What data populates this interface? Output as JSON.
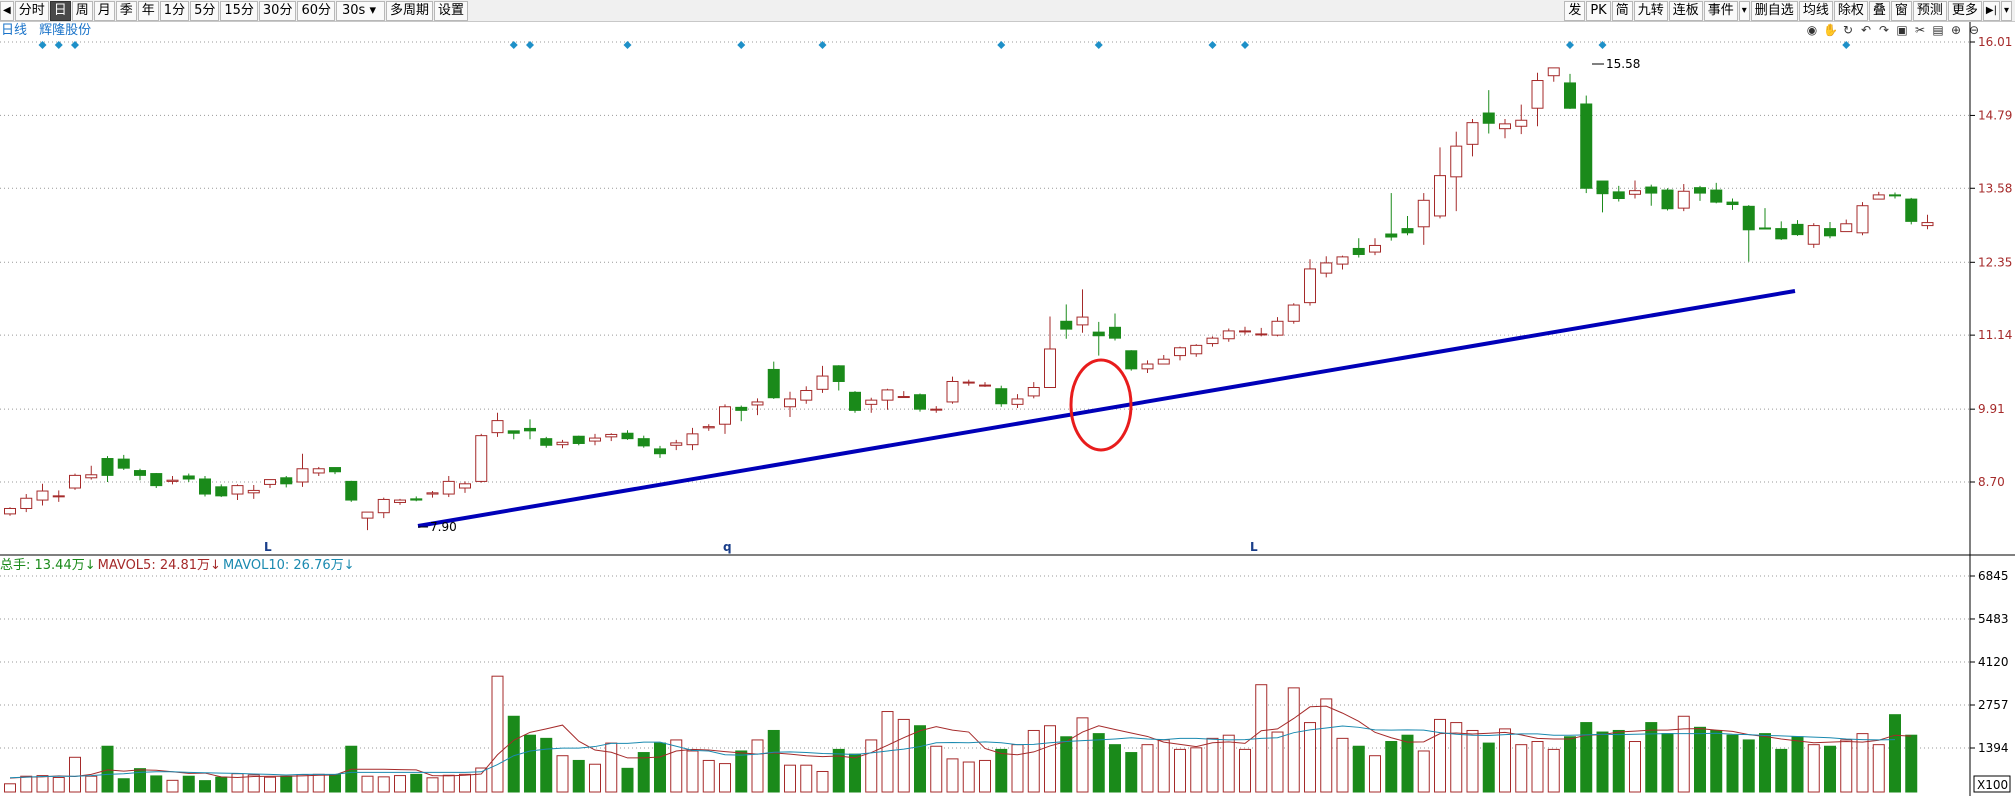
{
  "toolbar": {
    "left": [
      "分时",
      "日",
      "周",
      "月",
      "季",
      "年",
      "1分",
      "5分",
      "15分",
      "30分",
      "60分",
      "30s",
      "多周期",
      "设置"
    ],
    "right": [
      "发",
      "PK",
      "简",
      "九转",
      "连板",
      "事件",
      "删自选",
      "均线",
      "除权",
      "叠",
      "窗",
      "预测",
      "更多"
    ],
    "active": "日"
  },
  "stock": {
    "period": "日线",
    "name": "辉隆股份"
  },
  "tools": [
    "eye-icon",
    "hand-icon",
    "refresh-icon",
    "undo-icon",
    "redo-icon",
    "lock-icon",
    "scissors-icon",
    "delete-icon",
    "zoom-in-icon",
    "zoom-out-icon"
  ],
  "chart_data": [
    {
      "type": "candlestick",
      "title": "",
      "yticks": [
        16.01,
        14.79,
        13.58,
        12.35,
        11.14,
        9.91,
        8.7
      ],
      "ylim": [
        7.75,
        16.15
      ],
      "price_labels": {
        "high": "15.58",
        "low": "7.90"
      },
      "bottom_markers": [
        "L",
        "q",
        "L"
      ],
      "colors": {
        "up": "#a52a2a",
        "down": "#1a8a1a",
        "trend": "#0000b8",
        "circle": "#e81c1c",
        "diamond": "#1e90c8"
      },
      "candles": [
        [
          8.17,
          8.26,
          8.14,
          8.28
        ],
        [
          8.26,
          8.43,
          8.2,
          8.5
        ],
        [
          8.4,
          8.55,
          8.31,
          8.67
        ],
        [
          8.46,
          8.47,
          8.37,
          8.56
        ],
        [
          8.6,
          8.81,
          8.57,
          8.84
        ],
        [
          8.77,
          8.82,
          8.74,
          8.97
        ],
        [
          9.09,
          8.81,
          8.7,
          9.13
        ],
        [
          9.08,
          8.93,
          8.9,
          9.15
        ],
        [
          8.89,
          8.81,
          8.73,
          8.92
        ],
        [
          8.84,
          8.64,
          8.6,
          8.85
        ],
        [
          8.71,
          8.73,
          8.66,
          8.8
        ],
        [
          8.8,
          8.75,
          8.7,
          8.84
        ],
        [
          8.75,
          8.5,
          8.46,
          8.8
        ],
        [
          8.62,
          8.47,
          8.45,
          8.66
        ],
        [
          8.5,
          8.64,
          8.4,
          8.66
        ],
        [
          8.52,
          8.56,
          8.42,
          8.65
        ],
        [
          8.66,
          8.74,
          8.6,
          8.74
        ],
        [
          8.77,
          8.67,
          8.61,
          8.8
        ],
        [
          8.7,
          8.92,
          8.62,
          9.17
        ],
        [
          8.85,
          8.92,
          8.8,
          8.95
        ],
        [
          8.94,
          8.87,
          8.83,
          8.94
        ],
        [
          8.71,
          8.4,
          8.37,
          8.72
        ],
        [
          8.1,
          8.2,
          7.9,
          8.2
        ],
        [
          8.19,
          8.41,
          8.1,
          8.44
        ],
        [
          8.36,
          8.4,
          8.32,
          8.42
        ],
        [
          8.42,
          8.4,
          8.38,
          8.46
        ],
        [
          8.5,
          8.52,
          8.44,
          8.55
        ],
        [
          8.5,
          8.71,
          8.45,
          8.8
        ],
        [
          8.6,
          8.67,
          8.52,
          8.71
        ],
        [
          8.71,
          9.47,
          8.69,
          9.5
        ],
        [
          9.52,
          9.72,
          9.45,
          9.85
        ],
        [
          9.55,
          9.51,
          9.41,
          9.55
        ],
        [
          9.59,
          9.55,
          9.41,
          9.74
        ],
        [
          9.42,
          9.31,
          9.27,
          9.45
        ],
        [
          9.32,
          9.36,
          9.26,
          9.4
        ],
        [
          9.46,
          9.34,
          9.31,
          9.47
        ],
        [
          9.38,
          9.43,
          9.31,
          9.5
        ],
        [
          9.45,
          9.49,
          9.38,
          9.51
        ],
        [
          9.51,
          9.42,
          9.4,
          9.56
        ],
        [
          9.42,
          9.3,
          9.27,
          9.47
        ],
        [
          9.25,
          9.17,
          9.1,
          9.3
        ],
        [
          9.31,
          9.35,
          9.23,
          9.4
        ],
        [
          9.32,
          9.5,
          9.23,
          9.6
        ],
        [
          9.6,
          9.62,
          9.55,
          9.66
        ],
        [
          9.66,
          9.95,
          9.5,
          9.99
        ],
        [
          9.94,
          9.89,
          9.71,
          9.97
        ],
        [
          9.98,
          10.03,
          9.81,
          10.09
        ],
        [
          10.57,
          10.1,
          10.08,
          10.7
        ],
        [
          9.95,
          10.08,
          9.78,
          10.2
        ],
        [
          10.06,
          10.22,
          10.0,
          10.29
        ],
        [
          10.24,
          10.46,
          10.18,
          10.63
        ],
        [
          10.63,
          10.37,
          10.22,
          10.64
        ],
        [
          10.19,
          9.89,
          9.85,
          10.21
        ],
        [
          9.99,
          10.06,
          9.85,
          10.1
        ],
        [
          10.06,
          10.23,
          9.9,
          10.25
        ],
        [
          10.12,
          10.12,
          10.1,
          10.21
        ],
        [
          10.15,
          9.91,
          9.87,
          10.17
        ],
        [
          9.91,
          9.91,
          9.85,
          9.96
        ],
        [
          10.03,
          10.37,
          10.0,
          10.45
        ],
        [
          10.36,
          10.36,
          10.3,
          10.4
        ],
        [
          10.31,
          10.31,
          10.28,
          10.36
        ],
        [
          10.25,
          10.0,
          9.95,
          10.3
        ],
        [
          9.99,
          10.08,
          9.93,
          10.16
        ],
        [
          10.13,
          10.27,
          10.09,
          10.36
        ],
        [
          10.27,
          10.91,
          10.27,
          11.45
        ],
        [
          11.37,
          11.24,
          11.08,
          11.65
        ],
        [
          11.31,
          11.44,
          11.18,
          11.9
        ],
        [
          11.19,
          11.13,
          10.8,
          11.36
        ],
        [
          11.27,
          11.09,
          11.05,
          11.5
        ],
        [
          10.88,
          10.58,
          10.55,
          10.89
        ],
        [
          10.58,
          10.66,
          10.51,
          10.72
        ],
        [
          10.66,
          10.74,
          10.66,
          10.81
        ],
        [
          10.8,
          10.93,
          10.72,
          10.95
        ],
        [
          10.83,
          10.97,
          10.78,
          10.99
        ],
        [
          11.0,
          11.09,
          10.95,
          11.12
        ],
        [
          11.08,
          11.21,
          11.03,
          11.25
        ],
        [
          11.2,
          11.21,
          11.15,
          11.28
        ],
        [
          11.16,
          11.16,
          11.12,
          11.26
        ],
        [
          11.14,
          11.37,
          11.12,
          11.44
        ],
        [
          11.37,
          11.64,
          11.33,
          11.67
        ],
        [
          11.68,
          12.24,
          11.63,
          12.4
        ],
        [
          12.17,
          12.34,
          12.1,
          12.45
        ],
        [
          12.32,
          12.44,
          12.23,
          12.46
        ],
        [
          12.58,
          12.48,
          12.43,
          12.75
        ],
        [
          12.52,
          12.63,
          12.47,
          12.75
        ],
        [
          12.82,
          12.77,
          12.71,
          13.5
        ],
        [
          12.91,
          12.84,
          12.8,
          13.12
        ],
        [
          12.94,
          13.38,
          12.64,
          13.5
        ],
        [
          13.12,
          13.79,
          13.08,
          14.26
        ],
        [
          13.77,
          14.28,
          13.2,
          14.52
        ],
        [
          14.31,
          14.67,
          14.11,
          14.73
        ],
        [
          14.83,
          14.66,
          14.49,
          15.21
        ],
        [
          14.57,
          14.65,
          14.41,
          14.73
        ],
        [
          14.61,
          14.71,
          14.48,
          14.97
        ],
        [
          14.91,
          15.37,
          14.61,
          15.5
        ],
        [
          15.45,
          15.58,
          15.35,
          15.58
        ],
        [
          15.33,
          14.91,
          14.9,
          15.48
        ],
        [
          14.98,
          13.58,
          13.5,
          15.12
        ],
        [
          13.7,
          13.49,
          13.18,
          13.7
        ],
        [
          13.52,
          13.41,
          13.36,
          13.62
        ],
        [
          13.48,
          13.54,
          13.41,
          13.71
        ],
        [
          13.6,
          13.5,
          13.29,
          13.64
        ],
        [
          13.55,
          13.24,
          13.21,
          13.58
        ],
        [
          13.25,
          13.53,
          13.2,
          13.65
        ],
        [
          13.59,
          13.5,
          13.37,
          13.62
        ],
        [
          13.55,
          13.35,
          13.33,
          13.67
        ],
        [
          13.35,
          13.31,
          13.22,
          13.41
        ],
        [
          13.28,
          12.89,
          12.36,
          13.3
        ],
        [
          12.92,
          12.91,
          12.9,
          13.25
        ],
        [
          12.91,
          12.74,
          12.72,
          13.03
        ],
        [
          12.98,
          12.81,
          12.79,
          13.05
        ],
        [
          12.65,
          12.96,
          12.59,
          13.0
        ],
        [
          12.91,
          12.79,
          12.75,
          13.02
        ],
        [
          12.86,
          12.99,
          12.86,
          13.06
        ],
        [
          12.84,
          13.29,
          12.8,
          13.35
        ],
        [
          13.4,
          13.47,
          13.4,
          13.52
        ],
        [
          13.47,
          13.46,
          13.41,
          13.51
        ],
        [
          13.4,
          13.03,
          12.98,
          13.42
        ],
        [
          12.96,
          13.01,
          12.9,
          13.14
        ]
      ]
    },
    {
      "type": "bar",
      "title": "",
      "legend": [
        {
          "label": "总手: 13.44万↓",
          "color": "#1a8a1a"
        },
        {
          "label": "MAVOL5: 24.81万↓",
          "color": "#a52a2a"
        },
        {
          "label": "MAVOL10: 26.76万↓",
          "color": "#1a8ab0"
        }
      ],
      "yticks": [
        6845,
        5483,
        4120,
        2757,
        1394
      ],
      "ylim": [
        0,
        7050
      ],
      "unit_label": "X100",
      "volumes": [
        260,
        500,
        520,
        460,
        1100,
        500,
        1450,
        420,
        740,
        510,
        370,
        500,
        360,
        470,
        580,
        540,
        470,
        500,
        550,
        560,
        550,
        1450,
        500,
        480,
        520,
        560,
        450,
        530,
        560,
        760,
        3670,
        2400,
        1800,
        1700,
        1150,
        1000,
        880,
        1550,
        750,
        1250,
        1550,
        1650,
        1300,
        1000,
        900,
        1300,
        1650,
        1950,
        850,
        850,
        650,
        1350,
        1200,
        1650,
        2550,
        2300,
        2100,
        1450,
        1050,
        950,
        1000,
        1350,
        1500,
        1950,
        2100,
        1750,
        2350,
        1850,
        1500,
        1250,
        1500,
        1650,
        1350,
        1400,
        1700,
        1800,
        1350,
        3400,
        1900,
        3300,
        2200,
        2950,
        1700,
        1450,
        1150,
        1600,
        1800,
        1300,
        2300,
        2200,
        1950,
        1550,
        2000,
        1500,
        1600,
        1350,
        1750,
        2200,
        1900,
        1950,
        1600,
        2200,
        1850,
        2400,
        2050,
        1950,
        1800,
        1650,
        1850,
        1350,
        1750,
        1500,
        1450,
        1650,
        1850,
        1500,
        2450,
        1800
      ],
      "ma5": [
        440,
        470,
        480,
        510,
        490,
        560,
        700,
        660,
        700,
        690,
        640,
        590,
        600,
        480,
        460,
        490,
        500,
        500,
        510,
        530,
        540,
        720,
        720,
        720,
        710,
        700,
        520,
        510,
        530,
        570,
        1180,
        1640,
        1890,
        2000,
        2120,
        1610,
        1330,
        1260,
        1080,
        1080,
        1110,
        1300,
        1350,
        1330,
        1280,
        1240,
        1200,
        1240,
        1200,
        1150,
        1120,
        1140,
        1080,
        1250,
        1480,
        1720,
        1940,
        2070,
        1960,
        1900,
        1380,
        1220,
        1180,
        1270,
        1460,
        1600,
        1900,
        2100,
        1980,
        1870,
        1760,
        1580,
        1510,
        1440,
        1560,
        1590,
        1540,
        1940,
        2000,
        2330,
        2700,
        2720,
        2500,
        2240,
        1890,
        1720,
        1580,
        1590,
        1850,
        1870,
        1840,
        1860,
        1890,
        1810,
        1700,
        1680,
        1680,
        1800,
        1820,
        1900,
        1930,
        1960,
        1960,
        2000,
        2010,
        1960,
        1920,
        1820,
        1760,
        1680,
        1620,
        1560,
        1580,
        1600,
        1580,
        1640,
        1800,
        1770
      ],
      "ma10": [
        450,
        470,
        490,
        500,
        500,
        520,
        560,
        580,
        620,
        640,
        640,
        620,
        610,
        600,
        590,
        570,
        560,
        540,
        560,
        560,
        560,
        620,
        620,
        620,
        620,
        620,
        620,
        620,
        620,
        640,
        870,
        1150,
        1300,
        1360,
        1390,
        1390,
        1440,
        1540,
        1540,
        1580,
        1580,
        1450,
        1320,
        1300,
        1180,
        1170,
        1200,
        1260,
        1270,
        1250,
        1220,
        1210,
        1190,
        1240,
        1300,
        1360,
        1440,
        1560,
        1570,
        1560,
        1590,
        1560,
        1500,
        1510,
        1560,
        1600,
        1630,
        1650,
        1680,
        1720,
        1680,
        1660,
        1700,
        1700,
        1670,
        1650,
        1660,
        1700,
        1720,
        1880,
        1970,
        2030,
        2090,
        2050,
        1970,
        1960,
        1970,
        1960,
        1880,
        1830,
        1800,
        1790,
        1820,
        1840,
        1840,
        1800,
        1800,
        1810,
        1830,
        1820,
        1830,
        1840,
        1850,
        1850,
        1850,
        1860,
        1830,
        1820,
        1790,
        1780,
        1760,
        1740,
        1720,
        1680,
        1660,
        1650,
        1660
      ]
    }
  ]
}
